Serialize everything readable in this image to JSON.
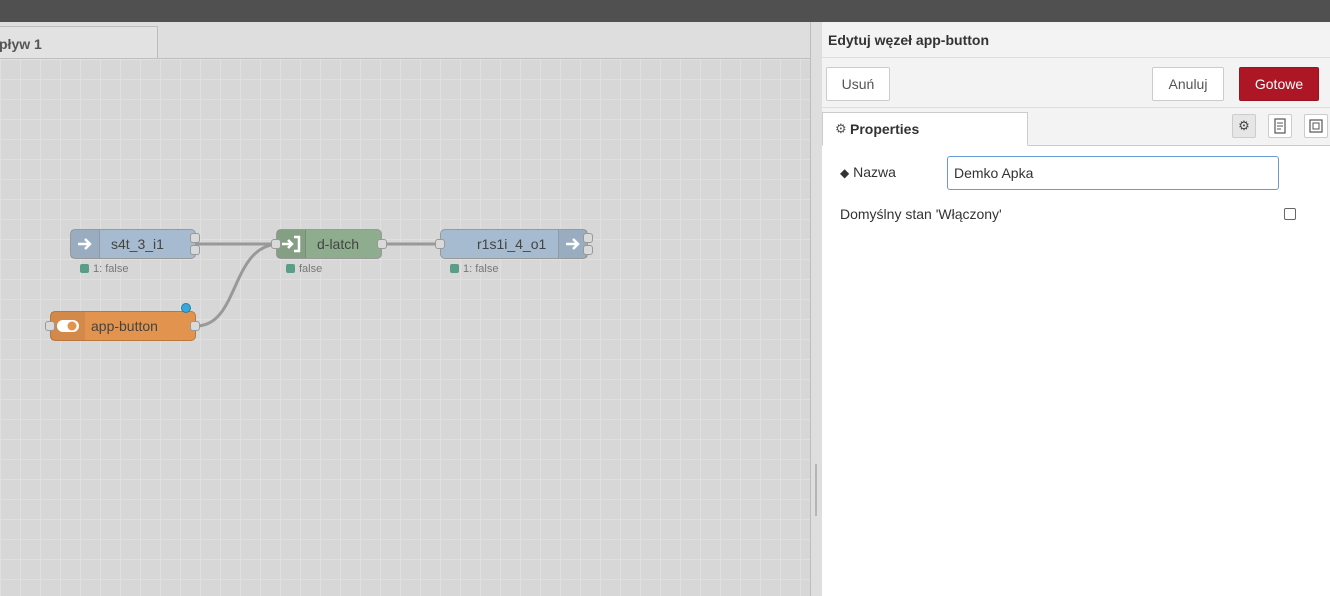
{
  "workspace": {
    "flow_tab_label": "pływ 1"
  },
  "nodes": {
    "s4t": {
      "label": "s4t_3_i1",
      "status": "1: false",
      "color": "#a6bbcf"
    },
    "dlatch": {
      "label": "d-latch",
      "status": "false",
      "color": "#8eac8e"
    },
    "r1s1i": {
      "label": "r1s1i_4_o1",
      "status": "1: false",
      "color": "#a6bbcf"
    },
    "appbutton": {
      "label": "app-button",
      "color": "#e2944f"
    }
  },
  "editor": {
    "title": "Edytuj węzeł app-button",
    "delete_label": "Usuń",
    "cancel_label": "Anuluj",
    "done_label": "Gotowe",
    "tab_properties": "Properties",
    "name_label": "Nazwa",
    "name_value": "Demko Apka",
    "default_state_label": "Domyślny stan 'Włączony'",
    "default_state_checked": false,
    "accent_color": "#ad1625"
  }
}
